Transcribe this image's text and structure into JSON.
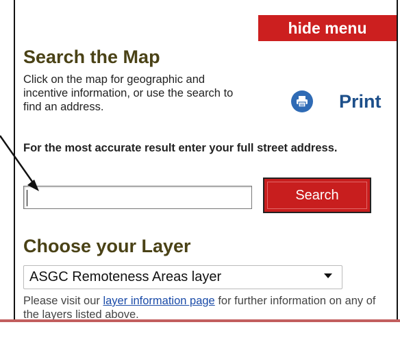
{
  "header": {
    "hide_menu_label": "hide menu"
  },
  "search_section": {
    "title": "Search the Map",
    "description": "Click on the map for geographic and incentive information, or use the search to find an address.",
    "hint": "For the most accurate result enter your full street address.",
    "input": {
      "value": "",
      "placeholder": ""
    },
    "button_label": "Search"
  },
  "print": {
    "label": "Print",
    "icon": "print-icon"
  },
  "layer_section": {
    "title": "Choose your Layer",
    "selected": "ASGC Remoteness Areas layer",
    "info_prefix": "Please visit our ",
    "info_link": "layer information page",
    "info_suffix": " for further information on any of the layers listed above."
  },
  "colors": {
    "accent_red": "#cc1f1f",
    "heading_olive": "#4a4216",
    "print_blue": "#1d4f8a",
    "link_blue": "#1a4ba8"
  }
}
